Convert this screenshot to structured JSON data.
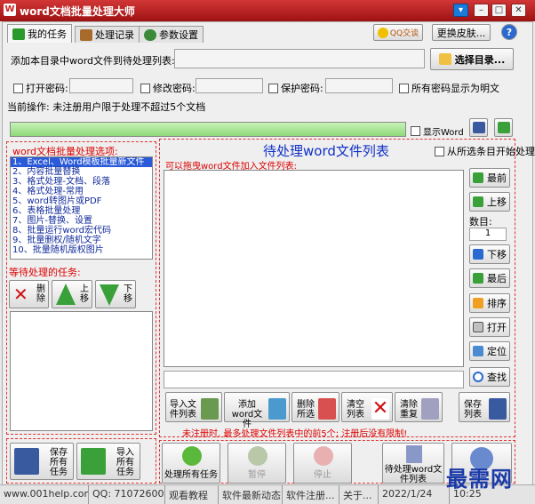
{
  "window": {
    "title": "word文档批量处理大师",
    "buttons": [
      "▾",
      "–",
      "□",
      "✕"
    ]
  },
  "tabs": [
    {
      "label": "我的任务",
      "color": "#2a9a2a"
    },
    {
      "label": "处理记录",
      "color": "#a86a2a"
    },
    {
      "label": "参数设置",
      "color": "#3a8a3a"
    }
  ],
  "header_buttons": {
    "qq": "QQ交谈",
    "skin": "更换皮肤...",
    "help": "?"
  },
  "add": {
    "label": "添加本目录中word文件到待处理列表:",
    "value": "",
    "select_dir": "选择目录..."
  },
  "passwords": {
    "open": "打开密码:",
    "modify": "修改密码:",
    "protect": "保护密码:",
    "show_plain": "所有密码显示为明文",
    "open_value": "",
    "modify_value": "",
    "protect_value": ""
  },
  "current_op": "当前操作: 未注册用户限于处理不超过5个文档",
  "progress": {
    "fraction": 1.0,
    "show_word": "显示Word"
  },
  "options": {
    "title": "word文档批量处理选项:",
    "items": [
      "1、Excel、Word模板批量新文件",
      "2、内容批量替换",
      "3、格式处理-文档、段落",
      "4、格式处理-常用",
      "5、word转图片或PDF",
      "6、表格批量处理",
      "7、图片-替换、设置",
      "8、批量运行word宏代码",
      "9、批量删权/随机文字",
      "10、批量随机版权图片"
    ],
    "selected_index": 0
  },
  "pending": {
    "title": "等待处理的任务:",
    "delete": "删除",
    "up": "上移",
    "down": "下移"
  },
  "filelist": {
    "title": "待处理word文件列表",
    "from_selected": "从所选条目开始处理",
    "drag_hint": "可以拖曳word文件加入文件列表:",
    "input_value": ""
  },
  "side": {
    "top": "最前",
    "up": "上移",
    "count_label": "数目:",
    "count": "1",
    "down": "下移",
    "last": "最后",
    "sort": "排序",
    "open": "打开",
    "locate": "定位",
    "find": "查找"
  },
  "bottom_actions": [
    "导入文件列表",
    "添加word文件",
    "删除所选",
    "清空列表",
    "清除重复"
  ],
  "save_list": "保存列表",
  "notice": "未注册时, 最多处理文件列表中的前5个; 注册后没有限制!",
  "footer": {
    "save_all": "保存所有任务",
    "import_all": "导入所有任务",
    "process_all": "处理所有任务",
    "pause": "暂停",
    "stop": "停止",
    "pending_list": "待处理word文件列表"
  },
  "status": [
    "www.001help.com",
    "QQ: 710726009",
    "观看教程",
    "软件最新动态",
    "软件注册...",
    "关于...",
    "2022/1/24",
    "10:25"
  ],
  "watermark": "最需网"
}
